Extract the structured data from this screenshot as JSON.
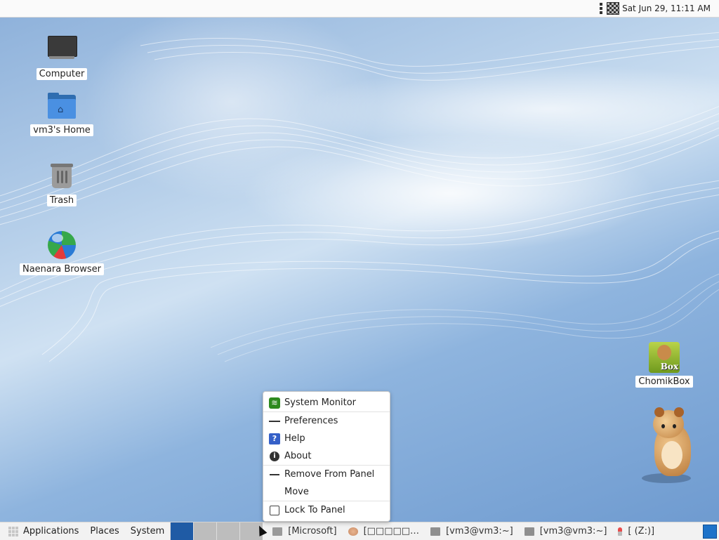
{
  "top_panel": {
    "clock": "Sat Jun 29, 11:11 AM"
  },
  "desktop": {
    "icons": [
      {
        "label": "Computer",
        "icon": "monitor-icon"
      },
      {
        "label": "vm3's Home",
        "icon": "home-folder-icon"
      },
      {
        "label": "Trash",
        "icon": "trash-icon"
      },
      {
        "label": "Naenara Browser",
        "icon": "globe-icon"
      },
      {
        "label": "ChomikBox",
        "icon": "chomikbox-icon"
      }
    ]
  },
  "context_menu": {
    "items": [
      {
        "label": "System Monitor",
        "icon": "system-monitor-icon"
      },
      {
        "label": "Preferences",
        "icon": "preferences-icon"
      },
      {
        "label": "Help",
        "icon": "help-icon"
      },
      {
        "label": "About",
        "icon": "info-icon"
      },
      {
        "label": "Remove From Panel",
        "icon": "remove-icon"
      },
      {
        "label": "Move",
        "icon": ""
      },
      {
        "label": "Lock To Panel",
        "icon": "checkbox-icon"
      }
    ]
  },
  "bottom_panel": {
    "menus": [
      "Applications",
      "Places",
      "System"
    ],
    "tasks": [
      {
        "label": "[Microsoft]",
        "icon": "folder-icon"
      },
      {
        "label": "[□□□□□…",
        "icon": "avatar-icon"
      },
      {
        "label": "[vm3@vm3:~]",
        "icon": "terminal-icon"
      },
      {
        "label": "[vm3@vm3:~]",
        "icon": "terminal-icon"
      },
      {
        "label": "[ (Z:)]",
        "icon": "pin-icon"
      }
    ]
  },
  "colors": {
    "active_workspace": "#1f5ba5",
    "menu_background": "#ffffff",
    "panel_background": "#f2f2f2"
  }
}
